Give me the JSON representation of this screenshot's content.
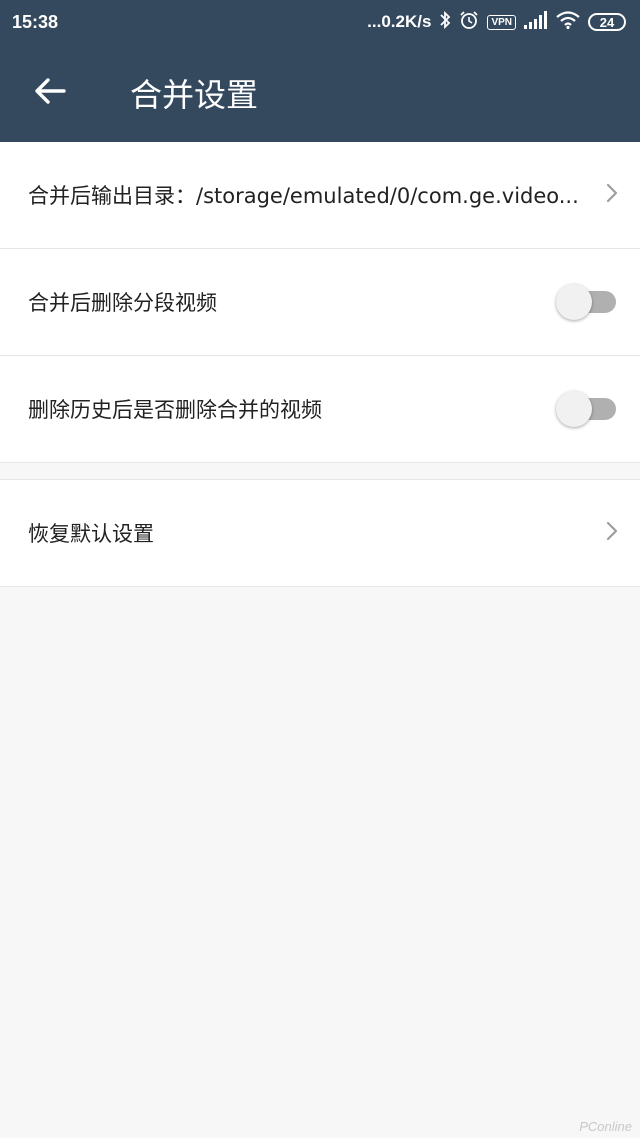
{
  "status_bar": {
    "time": "15:38",
    "network_speed": "...0.2K/s",
    "vpn": "VPN",
    "battery": "24"
  },
  "app_bar": {
    "title": "合并设置",
    "icons": {
      "back": "arrow-back-icon"
    }
  },
  "settings": [
    {
      "label": "合并后输出目录：/storage/emulated/0/com.ge.video...",
      "control": "chevron"
    },
    {
      "label": "合并后删除分段视频",
      "control": "toggle",
      "checked": false
    },
    {
      "label": "删除历史后是否删除合并的视频",
      "control": "toggle",
      "checked": false
    }
  ],
  "secondary_settings": [
    {
      "label": "恢复默认设置",
      "control": "chevron"
    }
  ],
  "watermark": "PConline",
  "colors": {
    "app_bar": "#34495e",
    "background": "#f7f7f7",
    "row_background": "#ffffff",
    "toggle_off_track": "#b0b0b0"
  }
}
